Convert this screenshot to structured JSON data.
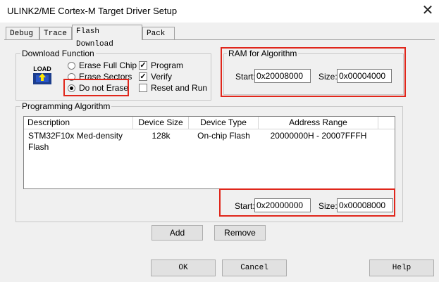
{
  "window": {
    "title": "ULINK2/ME Cortex-M Target Driver Setup",
    "close_label": "✕"
  },
  "tabs": [
    {
      "label": "Debug"
    },
    {
      "label": "Trace"
    },
    {
      "label": "Flash Download"
    },
    {
      "label": "Pack"
    }
  ],
  "download_function": {
    "group_label": "Download Function",
    "load_icon_text": "LOAD",
    "erase_full_chip": "Erase Full Chip",
    "erase_sectors": "Erase Sectors",
    "do_not_erase": "Do not Erase",
    "selected_erase": "Do not Erase",
    "program": {
      "label": "Program",
      "checked": true
    },
    "verify": {
      "label": "Verify",
      "checked": true
    },
    "reset_and_run": {
      "label": "Reset and Run",
      "checked": false
    }
  },
  "ram_for_algorithm": {
    "group_label": "RAM for Algorithm",
    "start_label": "Start:",
    "start_value": "0x20008000",
    "size_label": "Size:",
    "size_value": "0x00004000"
  },
  "programming_algorithm": {
    "group_label": "Programming Algorithm",
    "columns": [
      "Description",
      "Device Size",
      "Device Type",
      "Address Range"
    ],
    "rows": [
      [
        "STM32F10x Med-density Flash",
        "128k",
        "On-chip Flash",
        "20000000H - 20007FFFH"
      ]
    ],
    "start_label": "Start:",
    "start_value": "0x20000000",
    "size_label": "Size:",
    "size_value": "0x00008000",
    "add_label": "Add",
    "remove_label": "Remove"
  },
  "footer": {
    "ok_label": "OK",
    "cancel_label": "Cancel",
    "help_label": "Help"
  },
  "colors": {
    "highlight": "#e0261b",
    "window_bg": "#f0f0f0"
  }
}
